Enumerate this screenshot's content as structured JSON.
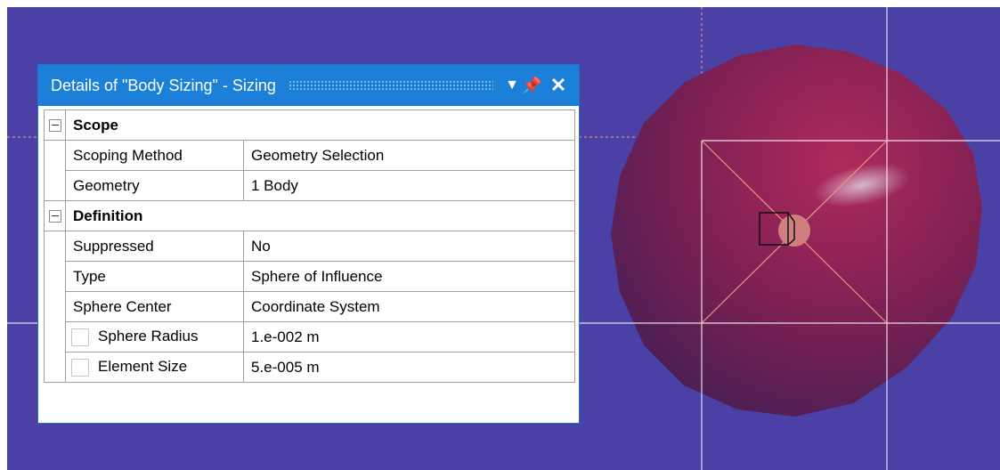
{
  "panel": {
    "title": "Details of \"Body Sizing\" - Sizing",
    "dropdown_icon": "chevron-down-icon",
    "pin_icon": "pin-icon",
    "close_icon": "close-icon",
    "rows": {
      "scope": {
        "label": "Scope"
      },
      "scoping_method": {
        "label": "Scoping Method",
        "value": "Geometry Selection"
      },
      "geometry": {
        "label": "Geometry",
        "value": "1 Body"
      },
      "definition": {
        "label": "Definition"
      },
      "suppressed": {
        "label": "Suppressed",
        "value": "No"
      },
      "type": {
        "label": "Type",
        "value": "Sphere of Influence"
      },
      "sphere_center": {
        "label": "Sphere Center",
        "value": "Coordinate System"
      },
      "sphere_radius": {
        "label": "Sphere Radius",
        "value": "1.e-002 m"
      },
      "element_size": {
        "label": "Element Size",
        "value": "5.e-005 m"
      }
    }
  },
  "colors": {
    "viewport_background": "#4a40a5",
    "title_bar": "#1c7fd8",
    "sphere": "#8a1f52"
  }
}
